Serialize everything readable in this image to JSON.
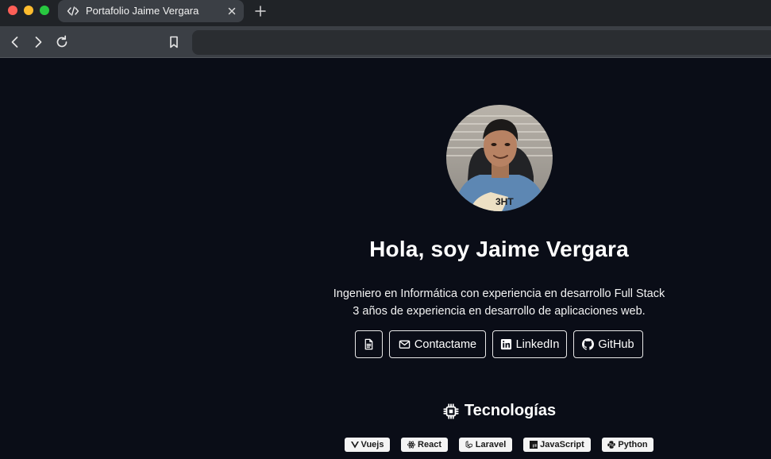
{
  "browser": {
    "tab_title": "Portafolio Jaime Vergara",
    "icons": {
      "tab": "code-icon",
      "close": "close-icon",
      "new_tab": "plus-icon",
      "back": "chevron-left-icon",
      "forward": "chevron-right-icon",
      "reload": "reload-icon",
      "bookmark": "bookmark-icon"
    },
    "address_value": ""
  },
  "hero": {
    "title": "Hola, soy Jaime Vergara",
    "line1": "Ingeniero en Informática con experiencia en desarrollo Full Stack",
    "line2": "3 años de experiencia en desarrollo de aplicaciones web.",
    "avatar_icon": "profile-photo"
  },
  "buttons": {
    "cv_icon": "document-icon",
    "contact_label": "Contactame",
    "contact_icon": "mail-icon",
    "linkedin_label": "LinkedIn",
    "linkedin_icon": "linkedin-icon",
    "github_label": "GitHub",
    "github_icon": "github-icon"
  },
  "tech": {
    "title": "Tecnologías",
    "icon": "chip-icon",
    "items": [
      {
        "label": "Vuejs",
        "icon": "vue-icon"
      },
      {
        "label": "React",
        "icon": "react-icon"
      },
      {
        "label": "Laravel",
        "icon": "laravel-icon"
      },
      {
        "label": "JavaScript",
        "icon": "javascript-icon"
      },
      {
        "label": "Python",
        "icon": "python-icon"
      }
    ]
  },
  "colors": {
    "page_bg": "#0a0d17",
    "chrome_tabbar": "#202327",
    "chrome_toolbar": "#3b3f45",
    "badge_bg": "#f4f4f4"
  }
}
